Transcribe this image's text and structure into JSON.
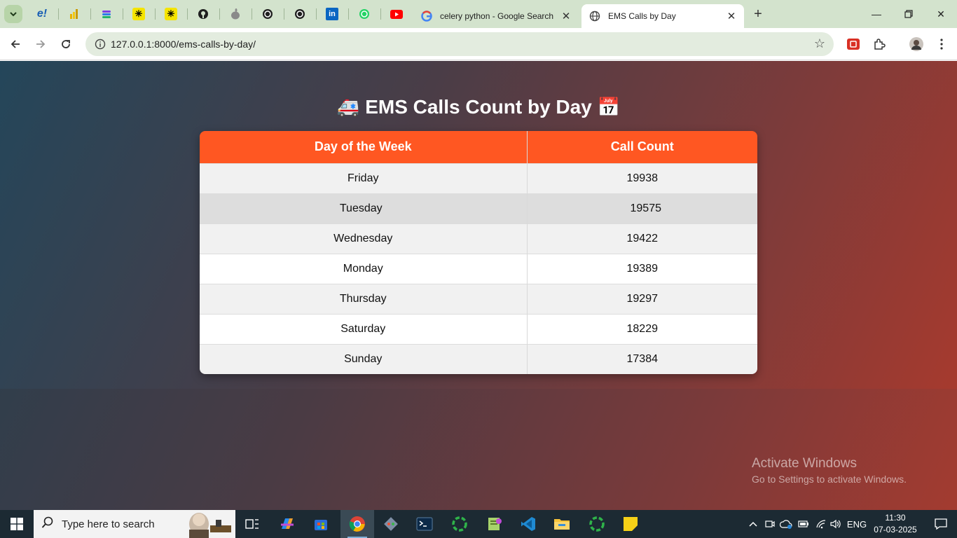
{
  "browser": {
    "pinned_tabs": [
      {
        "icon": "edureka-icon",
        "glyph": "e!"
      },
      {
        "icon": "power-bi-icon",
        "glyph": ""
      },
      {
        "icon": "stack-icon",
        "glyph": "≡"
      },
      {
        "icon": "perplexity-icon",
        "glyph": "✳"
      },
      {
        "icon": "perplexity-icon",
        "glyph": "✳"
      },
      {
        "icon": "github-icon",
        "glyph": "●"
      },
      {
        "icon": "apple-icon",
        "glyph": ""
      },
      {
        "icon": "openai-icon",
        "glyph": "⊛"
      },
      {
        "icon": "openai-icon",
        "glyph": "⊛"
      },
      {
        "icon": "linkedin-icon",
        "glyph": "in"
      },
      {
        "icon": "whatsapp-icon",
        "glyph": "✆"
      },
      {
        "icon": "youtube-icon",
        "glyph": "▶"
      }
    ],
    "tabs": [
      {
        "title": "celery python - Google Search",
        "icon": "google-icon"
      },
      {
        "title": "EMS Calls by Day",
        "icon": "globe-icon"
      }
    ],
    "url": "127.0.0.1:8000/ems-calls-by-day/"
  },
  "page": {
    "title": "EMS Calls Count by Day",
    "title_emoji_left": "🚑",
    "title_emoji_right": "📅",
    "columns": [
      "Day of the Week",
      "Call Count"
    ],
    "rows": [
      {
        "day": "Friday",
        "count": "19938"
      },
      {
        "day": "Tuesday",
        "count": "19575"
      },
      {
        "day": "Wednesday",
        "count": "19422"
      },
      {
        "day": "Monday",
        "count": "19389"
      },
      {
        "day": "Thursday",
        "count": "19297"
      },
      {
        "day": "Saturday",
        "count": "18229"
      },
      {
        "day": "Sunday",
        "count": "17384"
      }
    ]
  },
  "watermark": {
    "line1": "Activate Windows",
    "line2": "Go to Settings to activate Windows."
  },
  "taskbar": {
    "search_placeholder": "Type here to search",
    "language": "ENG",
    "time": "11:30",
    "date": "07-03-2025"
  },
  "colors": {
    "header_accent": "#ff5722",
    "tabstrip": "#d3e3cd"
  }
}
